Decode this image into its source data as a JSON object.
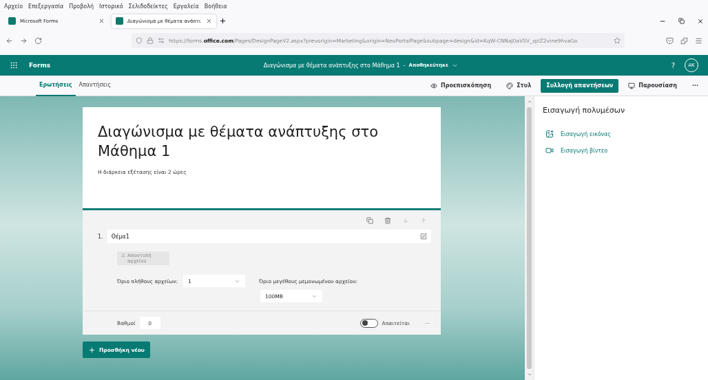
{
  "menu": [
    "Αρχείο",
    "Επεξεργασία",
    "Προβολή",
    "Ιστορικό",
    "Σελιδοδείκτες",
    "Εργαλεία",
    "Βοήθεια"
  ],
  "browser_tabs": [
    {
      "title": "Microsoft Forms",
      "selected": false
    },
    {
      "title": "Διαγώνισμα με θέματα ανάπτι",
      "selected": true
    }
  ],
  "address": {
    "url": "https://forms.**office.com**/Pages/DesignPageV2.aspx?prevorigin=Marketing&origin=NeoPortalPage&subpage=design&id=KqW-CNNaJ0aVSV_zplZ2vine9hvaGo"
  },
  "header": {
    "app_name": "Forms",
    "form_title": "Διαγώνισμα με θέματα ανάπτυξης στο Μάθημα 1",
    "separator": "-",
    "status": "Αποθηκεύτηκε",
    "help": "?",
    "avatar": "AK"
  },
  "nav_tabs": [
    {
      "label": "Ερωτήσεις",
      "selected": true
    },
    {
      "label": "Απαντήσεις",
      "selected": false
    }
  ],
  "actions": [
    {
      "kind": "preview",
      "label": "Προεπισκόπηση"
    },
    {
      "kind": "style",
      "label": "Στυλ"
    },
    {
      "kind": "primary",
      "label": "Συλλογή απαντήσεων"
    },
    {
      "kind": "present",
      "label": "Παρουσίαση"
    },
    {
      "kind": "more",
      "label": "···"
    }
  ],
  "form": {
    "title": "Διαγώνισμα με θέματα ανάπτυξης στο Μάθημα 1",
    "description": "Η διάρκεια εξέτασης είναι 2 ώρες"
  },
  "question": {
    "number": "1.",
    "title": "Θέμα1",
    "upload": {
      "label": "Αποστολή αρχείου",
      "disabled": true
    },
    "count_label": "Όριο πλήθους αρχείων:",
    "count_value": "1",
    "size_label": "Όριο μεγέθους μεμονωμένου αρχείου:",
    "size_value": "100MB",
    "points_label": "Βαθμοί",
    "points_value": "0",
    "required_label": "Απαιτείται",
    "required": false,
    "more": "···"
  },
  "add_button": {
    "label": "Προσθήκη νέου"
  },
  "side_panel": {
    "title": "Εισαγωγή πολυμέσων",
    "items": [
      {
        "kind": "image",
        "label": "Εισαγωγή εικόνας"
      },
      {
        "kind": "video",
        "label": "Εισαγωγή βίντεο"
      }
    ]
  }
}
